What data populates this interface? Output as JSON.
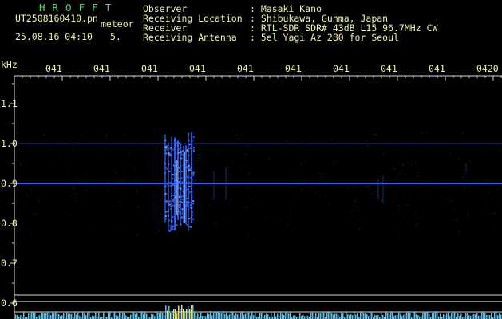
{
  "header": {
    "logo": "HROFFT",
    "filename": "UT2508160410.pn",
    "filename_suffix": "meteor",
    "datetime": "25.08.16 04:10",
    "count": "5.",
    "observer_label": "Observer",
    "observer_value": ": Masaki Kano",
    "location_label": "Receiving Location",
    "location_value": ": Shibukawa, Gunma, Japan",
    "receiver_label": "Receiver",
    "receiver_value": ": RTL-SDR SDR# 43dB L15 96.7MHz CW",
    "antenna_label": "Receiving Antenna",
    "antenna_value": ": 5el Yagi Az 280 for Seoul"
  },
  "chart_data": {
    "type": "heatmap",
    "ylabel": "kHz",
    "y_ticks": [
      "1.1",
      "1.0",
      "0.9",
      "0.8",
      "0.7",
      "0.6"
    ],
    "x_ticks": [
      "041",
      "041",
      "041",
      "041",
      "041",
      "041",
      "041",
      "041",
      "041",
      "0420"
    ],
    "grid": true,
    "colors": {
      "background": "#000000",
      "signal": "#3060ff",
      "grid": "#d8d8d8",
      "spectrum": "#40c8ff",
      "meteor_spectrum": "#f0e040"
    },
    "carrier_khz": [
      1.0,
      0.9
    ],
    "meteor_band_khz": [
      0.78,
      1.03
    ]
  }
}
